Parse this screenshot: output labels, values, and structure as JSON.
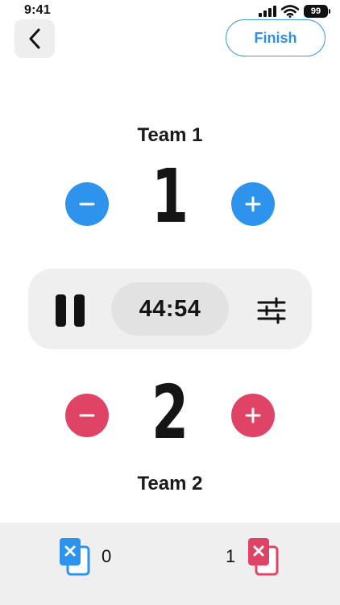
{
  "status_bar": {
    "time": "9:41",
    "battery": "99",
    "icons": [
      "signal-icon",
      "wifi-icon",
      "battery-icon"
    ]
  },
  "header": {
    "back_icon": "chevron-left-icon",
    "finish_label": "Finish"
  },
  "team1": {
    "name": "Team 1",
    "score": "1",
    "color": "#2d93ec"
  },
  "team2": {
    "name": "Team 2",
    "score": "2",
    "color": "#df4466"
  },
  "timer": {
    "value": "44:54",
    "pause_icon": "pause-icon",
    "settings_icon": "sliders-icon"
  },
  "cards": {
    "team1": {
      "count": "0",
      "icon": "card-x-icon",
      "color": "#2d93ec"
    },
    "team2": {
      "count": "1",
      "icon": "card-x-icon",
      "color": "#df4466"
    }
  }
}
